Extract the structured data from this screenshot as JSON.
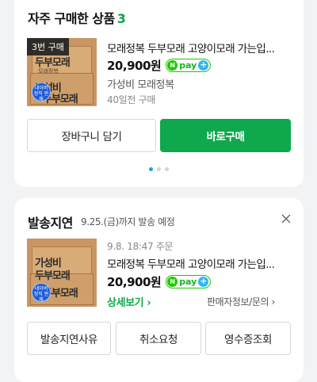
{
  "frequent": {
    "title": "자주 구매한 상품",
    "count": "3",
    "buy_badge": "3번 구매",
    "product_name": "모래정복 두부모래 고양이모래 가는입...",
    "price": "20,900원",
    "npay_label": "pay",
    "store": "가성비 모래정복",
    "purchased_ago": "40일전 구매",
    "cart_button": "장바구니 담기",
    "buy_button": "바로구매"
  },
  "thumb_art": {
    "line1": "가성비",
    "line2": "두부모래",
    "sub": "모래정복",
    "stamp": "네이버 정직 판매"
  },
  "shipping": {
    "title": "발송지연",
    "subtitle": "9.25.(금)까지 발송 예정",
    "order_date": "9.8. 18:47 주문",
    "product_name": "모래정복 두부모래 고양이모래 가는입...",
    "price": "20,900원",
    "npay_label": "pay",
    "detail_link": "상세보기 ›",
    "seller_link": "판매자정보/문의 ›",
    "actions": [
      "발송지연사유",
      "취소요청",
      "영수증조회"
    ]
  },
  "colors": {
    "accent": "#0fa84d",
    "npay": "#1ec800"
  }
}
